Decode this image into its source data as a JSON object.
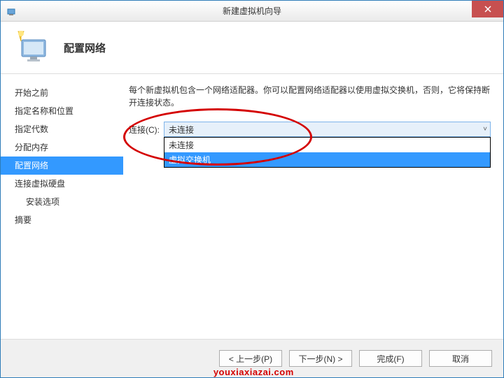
{
  "titlebar": {
    "title": "新建虚拟机向导",
    "close_tooltip": "关闭"
  },
  "header": {
    "title": "配置网络"
  },
  "sidebar": {
    "items": [
      {
        "label": "开始之前"
      },
      {
        "label": "指定名称和位置"
      },
      {
        "label": "指定代数"
      },
      {
        "label": "分配内存"
      },
      {
        "label": "配置网络",
        "selected": true
      },
      {
        "label": "连接虚拟硬盘"
      },
      {
        "label": "安装选项",
        "indent": true
      },
      {
        "label": "摘要"
      }
    ]
  },
  "main": {
    "description": "每个新虚拟机包含一个网络适配器。你可以配置网络适配器以使用虚拟交换机，否则，它将保持断开连接状态。",
    "connection_label": "连接(C):",
    "connection_selected": "未连接",
    "connection_options": [
      {
        "label": "未连接"
      },
      {
        "label": "虚拟交换机",
        "highlighted": true
      }
    ]
  },
  "footer": {
    "prev": "< 上一步(P)",
    "next": "下一步(N) >",
    "finish": "完成(F)",
    "cancel": "取消"
  },
  "watermark": "youxiaxiazai.com"
}
